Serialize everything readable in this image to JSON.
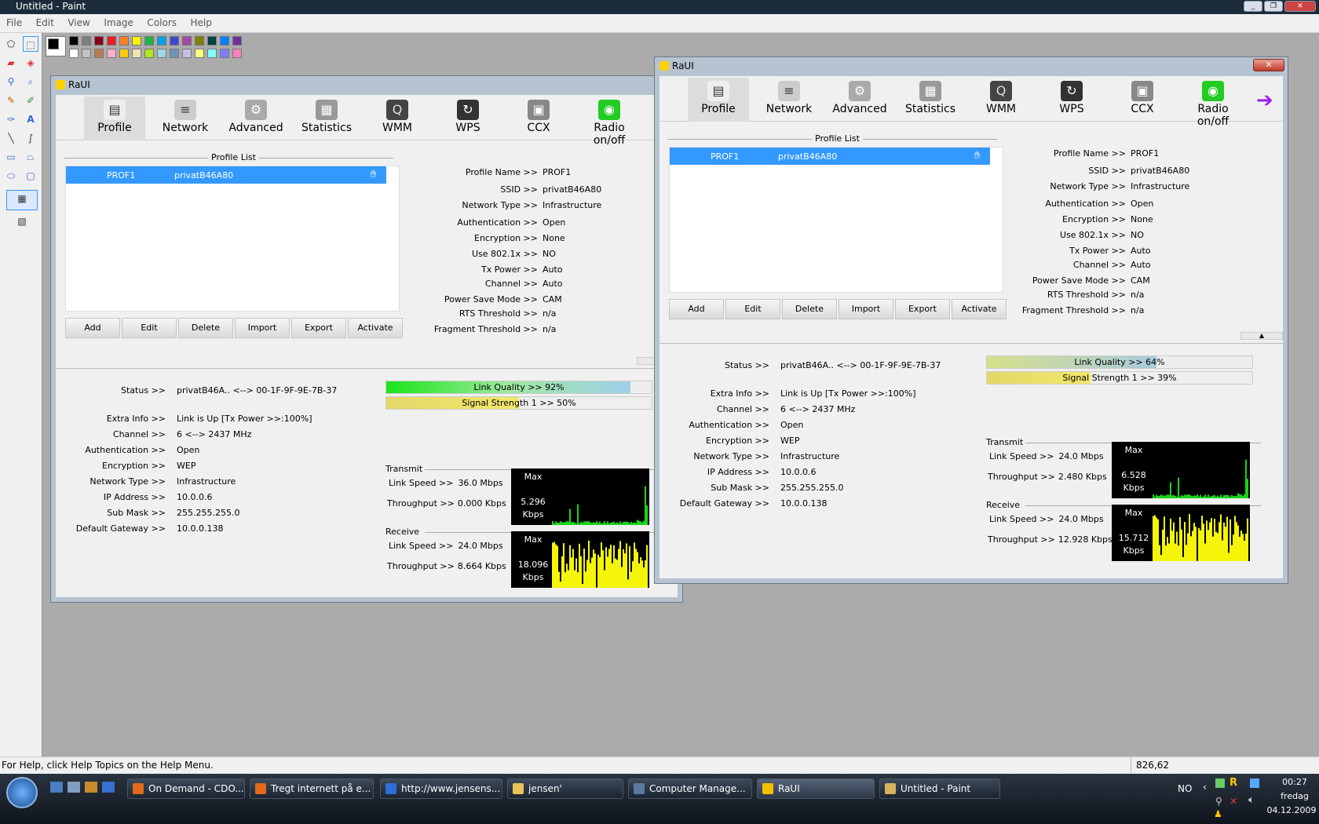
{
  "paint": {
    "title": "Untitled - Paint",
    "menu": [
      "File",
      "Edit",
      "View",
      "Image",
      "Colors",
      "Help"
    ],
    "status_help": "For Help, click Help Topics on the Help Menu.",
    "status_coords": "826,62",
    "palette_top": [
      "#000000",
      "#7f7f7f",
      "#880015",
      "#ed1c24",
      "#ff7f27",
      "#fff200",
      "#22b14c",
      "#00a2e8",
      "#3f48cc",
      "#a349a4",
      "#808000",
      "#004040",
      "#0080ff",
      "#6f3198"
    ],
    "palette_bottom": [
      "#ffffff",
      "#c3c3c3",
      "#b97a57",
      "#ffaec9",
      "#ffc90e",
      "#efe4b0",
      "#b5e61d",
      "#99d9ea",
      "#7092be",
      "#c8bfe7",
      "#ffff80",
      "#80ffff",
      "#8080ff",
      "#ff80c0"
    ]
  },
  "taskbar": {
    "items": [
      "On Demand - CDO...",
      "Tregt internett på e...",
      "http://www.jensens...",
      "jensen'",
      "Computer Manage...",
      "RaUI",
      "Untitled - Paint"
    ],
    "lang": "NO",
    "time": "00:27",
    "day": "fredag",
    "date": "04.12.2009"
  },
  "raui_left": {
    "title": "RaUI",
    "toolbar": [
      "Profile",
      "Network",
      "Advanced",
      "Statistics",
      "WMM",
      "WPS",
      "CCX",
      "Radio on/off"
    ],
    "profile_list_label": "Profile List",
    "profile": {
      "name": "PROF1",
      "ssid": "privatB46A80"
    },
    "buttons": [
      "Add",
      "Edit",
      "Delete",
      "Import",
      "Export",
      "Activate"
    ],
    "details": [
      {
        "k": "Profile Name >>",
        "v": "PROF1"
      },
      {
        "k": "SSID >>",
        "v": "privatB46A80"
      },
      {
        "k": "Network Type >>",
        "v": "Infrastructure"
      },
      {
        "k": "Authentication >>",
        "v": "Open"
      },
      {
        "k": "Encryption >>",
        "v": "None"
      },
      {
        "k": "Use 802.1x >>",
        "v": "NO"
      },
      {
        "k": "Tx Power >>",
        "v": "Auto"
      },
      {
        "k": "Channel >>",
        "v": "Auto"
      },
      {
        "k": "Power Save Mode >>",
        "v": "CAM"
      },
      {
        "k": "RTS Threshold >>",
        "v": "n/a"
      },
      {
        "k": "Fragment Threshold >>",
        "v": "n/a"
      }
    ],
    "status": [
      {
        "k": "Status >>",
        "v": "privatB46A.. <--> 00-1F-9F-9E-7B-37"
      },
      {
        "k": "Extra Info >>",
        "v": "Link is Up [Tx Power >>:100%]"
      },
      {
        "k": "Channel >>",
        "v": "6 <--> 2437 MHz"
      },
      {
        "k": "Authentication >>",
        "v": "Open"
      },
      {
        "k": "Encryption >>",
        "v": "WEP"
      },
      {
        "k": "Network Type >>",
        "v": "Infrastructure"
      },
      {
        "k": "IP Address >>",
        "v": "10.0.0.6"
      },
      {
        "k": "Sub Mask >>",
        "v": "255.255.255.0"
      },
      {
        "k": "Default Gateway >>",
        "v": "10.0.0.138"
      }
    ],
    "link_quality": {
      "label": "Link Quality >> 92%",
      "value": 0.92
    },
    "signal": {
      "label": "Signal Strength 1 >> 50%",
      "value": 0.5
    },
    "transmit": {
      "label": "Transmit",
      "link_speed_k": "Link Speed >>",
      "link_speed_v": "36.0 Mbps",
      "throughput_k": "Throughput >>",
      "throughput_v": "0.000 Kbps",
      "max": "Max",
      "val": "5.296",
      "unit": "Kbps"
    },
    "receive": {
      "label": "Receive",
      "link_speed_k": "Link Speed >>",
      "link_speed_v": "24.0 Mbps",
      "throughput_k": "Throughput >>",
      "throughput_v": "8.664 Kbps",
      "max": "Max",
      "val": "18.096",
      "unit": "Kbps"
    }
  },
  "raui_right": {
    "title": "RaUI",
    "toolbar": [
      "Profile",
      "Network",
      "Advanced",
      "Statistics",
      "WMM",
      "WPS",
      "CCX",
      "Radio on/off"
    ],
    "profile_list_label": "Profile List",
    "profile": {
      "name": "PROF1",
      "ssid": "privatB46A80"
    },
    "buttons": [
      "Add",
      "Edit",
      "Delete",
      "Import",
      "Export",
      "Activate"
    ],
    "details": [
      {
        "k": "Profile Name >>",
        "v": "PROF1"
      },
      {
        "k": "SSID >>",
        "v": "privatB46A80"
      },
      {
        "k": "Network Type >>",
        "v": "Infrastructure"
      },
      {
        "k": "Authentication >>",
        "v": "Open"
      },
      {
        "k": "Encryption >>",
        "v": "None"
      },
      {
        "k": "Use 802.1x >>",
        "v": "NO"
      },
      {
        "k": "Tx Power >>",
        "v": "Auto"
      },
      {
        "k": "Channel >>",
        "v": "Auto"
      },
      {
        "k": "Power Save Mode >>",
        "v": "CAM"
      },
      {
        "k": "RTS Threshold >>",
        "v": "n/a"
      },
      {
        "k": "Fragment Threshold >>",
        "v": "n/a"
      }
    ],
    "status": [
      {
        "k": "Status >>",
        "v": "privatB46A.. <--> 00-1F-9F-9E-7B-37"
      },
      {
        "k": "Extra Info >>",
        "v": "Link is Up [Tx Power >>:100%]"
      },
      {
        "k": "Channel >>",
        "v": "6 <--> 2437 MHz"
      },
      {
        "k": "Authentication >>",
        "v": "Open"
      },
      {
        "k": "Encryption >>",
        "v": "WEP"
      },
      {
        "k": "Network Type >>",
        "v": "Infrastructure"
      },
      {
        "k": "IP Address >>",
        "v": "10.0.0.6"
      },
      {
        "k": "Sub Mask >>",
        "v": "255.255.255.0"
      },
      {
        "k": "Default Gateway >>",
        "v": "10.0.0.138"
      }
    ],
    "link_quality": {
      "label": "Link Quality >> 64%",
      "value": 0.64
    },
    "signal": {
      "label": "Signal Strength 1 >> 39%",
      "value": 0.39
    },
    "transmit": {
      "label": "Transmit",
      "link_speed_k": "Link Speed >>",
      "link_speed_v": "24.0 Mbps",
      "throughput_k": "Throughput >>",
      "throughput_v": "2.480 Kbps",
      "max": "Max",
      "val": "6.528",
      "unit": "Kbps"
    },
    "receive": {
      "label": "Receive",
      "link_speed_k": "Link Speed >>",
      "link_speed_v": "24.0 Mbps",
      "throughput_k": "Throughput >>",
      "throughput_v": "12.928 Kbps",
      "max": "Max",
      "val": "15.712",
      "unit": "Kbps"
    }
  }
}
